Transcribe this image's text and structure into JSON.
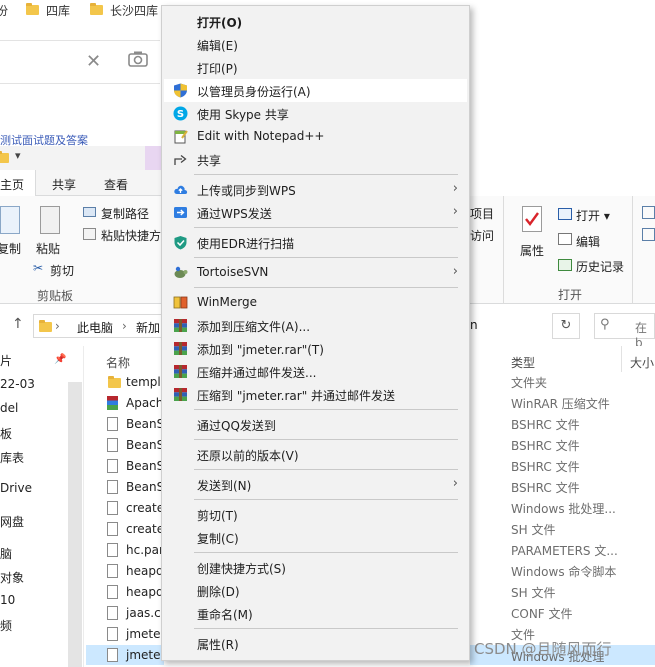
{
  "bookmarks": [
    "份",
    "四库",
    "长沙四库"
  ],
  "under_link": "测试面试题及答案",
  "explorer": {
    "tabs": [
      "主页",
      "共享",
      "查看"
    ],
    "ribbon": {
      "copy_path": "复制路径",
      "paste_shortcut": "粘贴快捷方式",
      "copy_label": "复制",
      "paste_label": "粘贴",
      "cut": "剪切",
      "clipboard_group": "剪贴板",
      "open": "打开",
      "edit": "编辑",
      "history": "历史记录",
      "properties": "属性",
      "open_group": "打开",
      "partial_a": "项目",
      "partial_b": "访问"
    },
    "address": {
      "this_pc": "此电脑",
      "sep": "›",
      "new_vol": "新加",
      "search_partial": "在 b"
    },
    "nav_items": [
      "片",
      "22-03",
      "del",
      "板",
      "库表",
      "Drive",
      "网盘",
      "脑",
      "对象",
      "10",
      "频"
    ],
    "columns": {
      "name": "名称",
      "type": "类型",
      "size": "大小"
    },
    "files": [
      "templ",
      "Apach",
      "BeanS",
      "BeanS",
      "BeanS",
      "BeanS",
      "create",
      "create",
      "hc.par",
      "heapd",
      "heapd",
      "jaas.c",
      "jmeter",
      "jmeter"
    ],
    "types": [
      "文件夹",
      "WinRAR 压缩文件",
      "BSHRC 文件",
      "BSHRC 文件",
      "BSHRC 文件",
      "BSHRC 文件",
      "Windows 批处理...",
      "SH 文件",
      "PARAMETERS 文...",
      "Windows 命令脚本",
      "SH 文件",
      "CONF 文件",
      "文件",
      "Windows 批处理"
    ]
  },
  "watermark": "CSDN @且随风而行",
  "context_menu": {
    "items": [
      {
        "label": "打开(O)",
        "bold": true,
        "icon": "none"
      },
      {
        "label": "编辑(E)",
        "icon": "none"
      },
      {
        "label": "打印(P)",
        "icon": "none"
      },
      {
        "label": "以管理员身份运行(A)",
        "icon": "uac-shield-icon"
      },
      {
        "label": "使用 Skype 共享",
        "icon": "skype-icon"
      },
      {
        "label": "Edit with Notepad++",
        "icon": "notepad-plus-plus-icon"
      },
      {
        "label": "共享",
        "icon": "share-icon"
      },
      {
        "label": "上传或同步到WPS",
        "icon": "wps-cloud-icon",
        "submenu": true
      },
      {
        "label": "通过WPS发送",
        "icon": "wps-send-icon",
        "submenu": true
      },
      {
        "label": "使用EDR进行扫描",
        "icon": "edr-scan-icon"
      },
      {
        "label": "TortoiseSVN",
        "icon": "tortoise-svn-icon",
        "submenu": true
      },
      {
        "label": "WinMerge",
        "icon": "winmerge-icon"
      },
      {
        "label": "添加到压缩文件(A)...",
        "icon": "winrar-icon"
      },
      {
        "label": "添加到 \"jmeter.rar\"(T)",
        "icon": "winrar-icon"
      },
      {
        "label": "压缩并通过邮件发送...",
        "icon": "winrar-icon"
      },
      {
        "label": "压缩到 \"jmeter.rar\" 并通过邮件发送",
        "icon": "winrar-icon"
      },
      {
        "label": "通过QQ发送到",
        "icon": "none"
      },
      {
        "label": "还原以前的版本(V)",
        "icon": "none"
      },
      {
        "label": "发送到(N)",
        "icon": "none",
        "submenu": true
      },
      {
        "label": "剪切(T)",
        "icon": "none"
      },
      {
        "label": "复制(C)",
        "icon": "none"
      },
      {
        "label": "创建快捷方式(S)",
        "icon": "none"
      },
      {
        "label": "删除(D)",
        "icon": "none"
      },
      {
        "label": "重命名(M)",
        "icon": "none"
      },
      {
        "label": "属性(R)",
        "icon": "none"
      }
    ],
    "hovered_item": "以管理员身份运行(A)",
    "submenu_arrow": "›"
  },
  "colors": {
    "menu_bg": "#f2f2f2",
    "menu_hover": "#ffffff",
    "selection": "#cce8ff",
    "folder": "#f3c64b",
    "winrar_red": "#b7282e",
    "wps_blue": "#2f7de1"
  }
}
